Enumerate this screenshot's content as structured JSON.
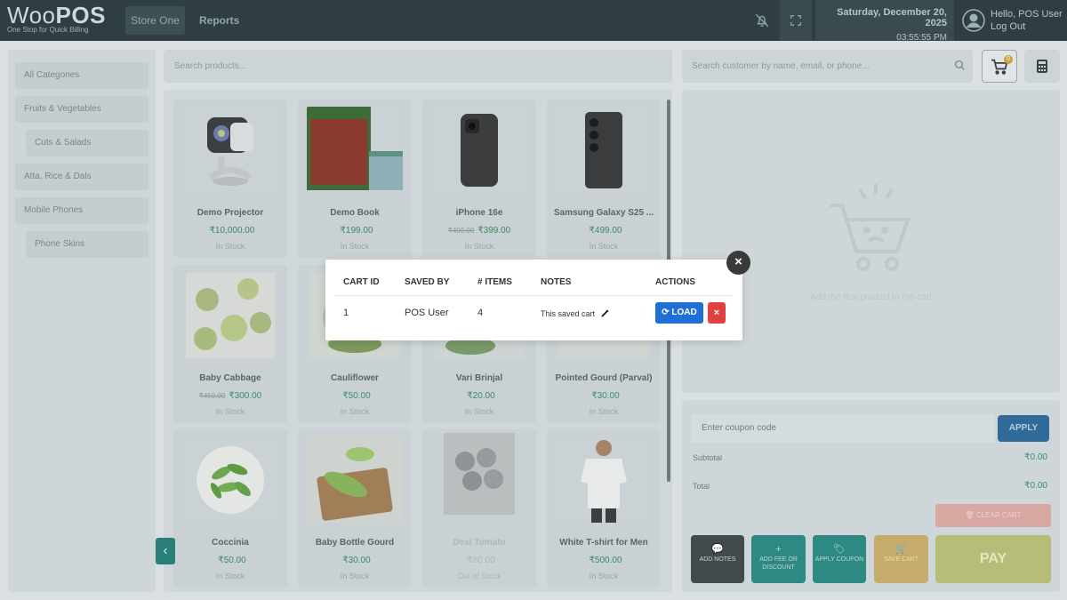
{
  "header": {
    "logo_light": "Woo",
    "logo_bold": "POS",
    "tagline": "One Stop for Quick Billing",
    "store_button": "Store One",
    "reports_link": "Reports",
    "date": "Saturday, December 20, 2025",
    "time": "03:55:55 PM",
    "greeting": "Hello, POS User",
    "logout": "Log Out"
  },
  "sidebar": {
    "items": [
      {
        "label": "All Categories",
        "sub": false
      },
      {
        "label": "Fruits & Vegetables",
        "sub": false
      },
      {
        "label": "Cuts & Salads",
        "sub": true
      },
      {
        "label": "Atta, Rice & Dals",
        "sub": false
      },
      {
        "label": "Mobile Phones",
        "sub": false
      },
      {
        "label": "Phone Skins",
        "sub": true
      }
    ]
  },
  "search": {
    "products_placeholder": "Search products...",
    "customer_placeholder": "Search customer by name, email, or phone..."
  },
  "products": [
    {
      "name": "Demo Projector",
      "old_price": "",
      "price": "₹10,000.00",
      "stock": "In Stock"
    },
    {
      "name": "Demo Book",
      "old_price": "",
      "price": "₹199.00",
      "stock": "In Stock"
    },
    {
      "name": "iPhone 16e",
      "old_price": "₹400.00",
      "price": "₹399.00",
      "stock": "In Stock"
    },
    {
      "name": "Samsung Galaxy S25 ...",
      "old_price": "",
      "price": "₹499.00",
      "stock": "In Stock"
    },
    {
      "name": "Baby Cabbage",
      "old_price": "₹450.00",
      "price": "₹300.00",
      "stock": "In Stock"
    },
    {
      "name": "Cauliflower",
      "old_price": "",
      "price": "₹50.00",
      "stock": "In Stock"
    },
    {
      "name": "Vari Brinjal",
      "old_price": "",
      "price": "₹20.00",
      "stock": "In Stock"
    },
    {
      "name": "Pointed Gourd (Parval)",
      "old_price": "",
      "price": "₹30.00",
      "stock": "In Stock"
    },
    {
      "name": "Coccinia",
      "old_price": "",
      "price": "₹50.00",
      "stock": "In Stock"
    },
    {
      "name": "Baby Bottle Gourd",
      "old_price": "",
      "price": "₹30.00",
      "stock": "In Stock"
    },
    {
      "name": "Desi Tomato",
      "old_price": "",
      "price": "₹80.00",
      "stock": "Out of Stock"
    },
    {
      "name": "White T-shirt for Men",
      "old_price": "",
      "price": "₹500.00",
      "stock": "In Stock"
    }
  ],
  "cart": {
    "badge_count": "0",
    "empty_text": "Add the first product to the cart"
  },
  "summary": {
    "coupon_placeholder": "Enter coupon code",
    "apply_label": "APPLY",
    "subtotal_label": "Subtotal",
    "subtotal_value": "₹0.00",
    "total_label": "Total",
    "total_value": "₹0.00",
    "clear_cart_label": "CLEAR CART",
    "add_notes_label": "ADD NOTES",
    "add_fee_label": "ADD FEE OR DISCOUNT",
    "apply_coupon_label": "APPLY COUPON",
    "save_cart_label": "SAVE CART",
    "pay_label": "PAY"
  },
  "modal": {
    "headers": {
      "cart_id": "CART ID",
      "saved_by": "SAVED BY",
      "items": "# ITEMS",
      "notes": "NOTES",
      "actions": "ACTIONS"
    },
    "row": {
      "cart_id": "1",
      "saved_by": "POS User",
      "items": "4",
      "notes": "This saved cart"
    },
    "load_label": "LOAD",
    "close_glyph": "×",
    "delete_glyph": "×"
  },
  "colors": {
    "topbar": "#2f3e40",
    "accent_teal": "#2c8a83",
    "load_blue": "#1f6fd6",
    "delete_red": "#e04040",
    "price_green": "#3d8a66"
  }
}
